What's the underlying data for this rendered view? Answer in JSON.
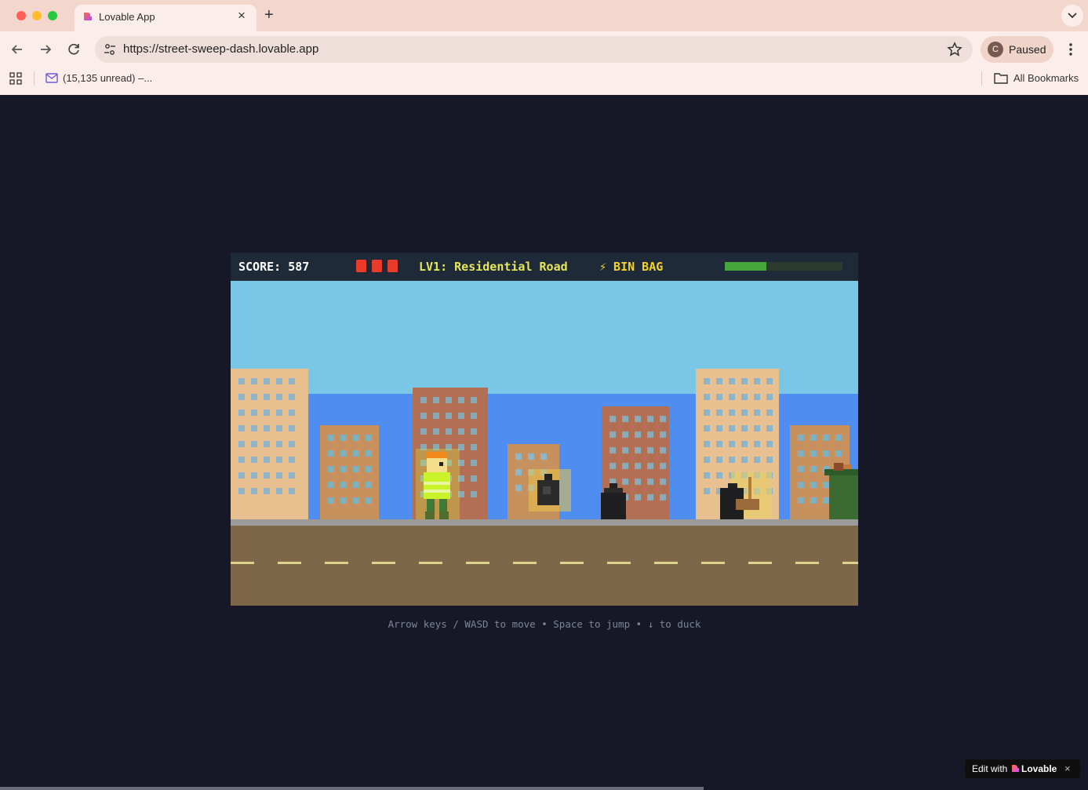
{
  "browser": {
    "tab_title": "Lovable App",
    "tab_close": "×",
    "new_tab": "+",
    "url": "https://street-sweep-dash.lovable.app",
    "profile_initial": "C",
    "profile_status": "Paused",
    "bookmarks": [
      {
        "label": "(15,135 unread) –...",
        "icon": "mail-icon"
      }
    ],
    "all_bookmarks": "All Bookmarks"
  },
  "game": {
    "hud": {
      "score_label": "SCORE: 587",
      "lives": 3,
      "level": "LV1: Residential Road",
      "powerup": "⚡ BIN BAG",
      "power_fraction": 0.35
    },
    "colors": {
      "sky": "#7ac6e7",
      "wall": "#4f8df0",
      "road": "#7e6749",
      "lane": "#dcd38e",
      "hud_bg": "#1f2a38"
    },
    "hint": "Arrow keys / WASD to move • Space to jump • ↓ to duck"
  },
  "badge": {
    "edit_with": "Edit with",
    "brand": "Lovable",
    "close": "×"
  }
}
